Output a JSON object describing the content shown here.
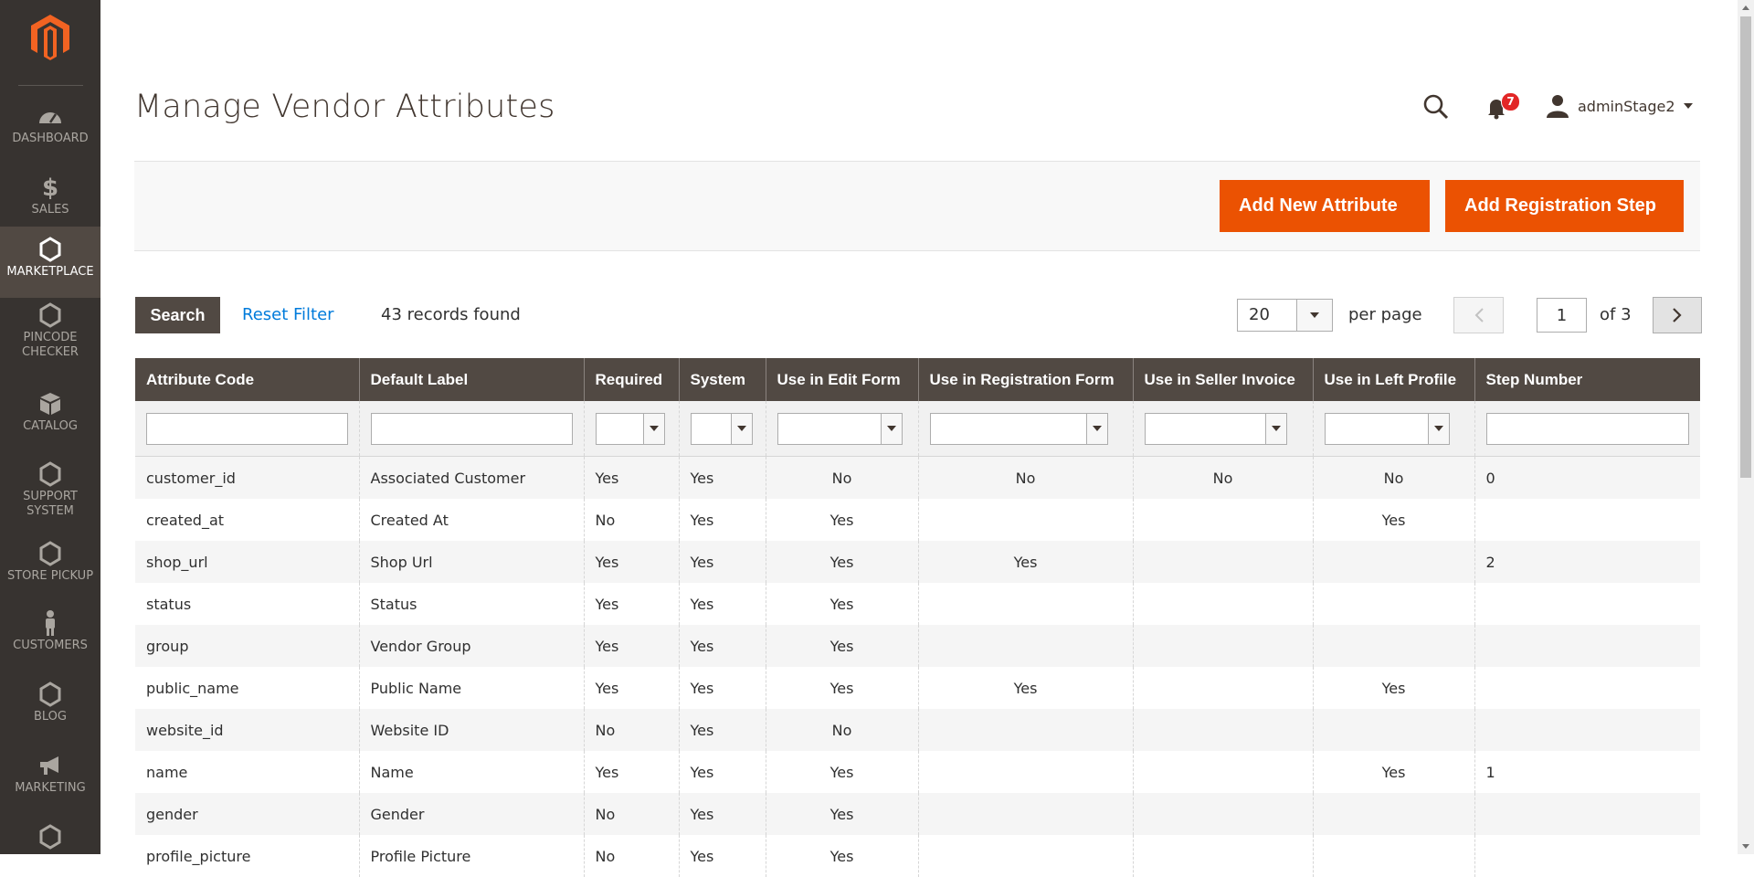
{
  "page": {
    "title": "Manage Vendor Attributes"
  },
  "header": {
    "notifications_count": "7",
    "username": "adminStage2"
  },
  "nav": [
    {
      "label": "DASHBOARD",
      "icon": "dashboard-icon"
    },
    {
      "label": "SALES",
      "icon": "dollar-icon"
    },
    {
      "label": "MARKETPLACE",
      "icon": "hexagon-icon",
      "active": true
    },
    {
      "label": "PINCODE CHECKER",
      "icon": "hexagon-icon"
    },
    {
      "label": "CATALOG",
      "icon": "box-icon"
    },
    {
      "label": "SUPPORT SYSTEM",
      "icon": "hexagon-icon"
    },
    {
      "label": "STORE PICKUP",
      "icon": "hexagon-icon"
    },
    {
      "label": "CUSTOMERS",
      "icon": "person-icon"
    },
    {
      "label": "BLOG",
      "icon": "hexagon-icon"
    },
    {
      "label": "MARKETING",
      "icon": "megaphone-icon"
    },
    {
      "label": "",
      "icon": "hexagon-icon"
    }
  ],
  "actions": {
    "add_attribute": "Add New Attribute",
    "add_step": "Add Registration Step"
  },
  "toolbar": {
    "search_label": "Search",
    "reset_label": "Reset Filter",
    "records": "43 records found",
    "per_page_value": "20",
    "per_page_label": "per page",
    "page_value": "1",
    "page_of": "of 3"
  },
  "table": {
    "columns": [
      "Attribute Code",
      "Default Label",
      "Required",
      "System",
      "Use in Edit Form",
      "Use in Registration Form",
      "Use in Seller Invoice",
      "Use in Left Profile",
      "Step Number"
    ],
    "rows": [
      [
        "customer_id",
        "Associated Customer",
        "Yes",
        "Yes",
        "No",
        "No",
        "No",
        "No",
        "0"
      ],
      [
        "created_at",
        "Created At",
        "No",
        "Yes",
        "Yes",
        "",
        "",
        "Yes",
        ""
      ],
      [
        "shop_url",
        "Shop Url",
        "Yes",
        "Yes",
        "Yes",
        "Yes",
        "",
        "",
        "2"
      ],
      [
        "status",
        "Status",
        "Yes",
        "Yes",
        "Yes",
        "",
        "",
        "",
        ""
      ],
      [
        "group",
        "Vendor Group",
        "Yes",
        "Yes",
        "Yes",
        "",
        "",
        "",
        ""
      ],
      [
        "public_name",
        "Public Name",
        "Yes",
        "Yes",
        "Yes",
        "Yes",
        "",
        "Yes",
        ""
      ],
      [
        "website_id",
        "Website ID",
        "No",
        "Yes",
        "No",
        "",
        "",
        "",
        ""
      ],
      [
        "name",
        "Name",
        "Yes",
        "Yes",
        "Yes",
        "",
        "",
        "Yes",
        "1"
      ],
      [
        "gender",
        "Gender",
        "No",
        "Yes",
        "Yes",
        "",
        "",
        "",
        ""
      ],
      [
        "profile_picture",
        "Profile Picture",
        "No",
        "Yes",
        "Yes",
        "",
        "",
        "",
        ""
      ]
    ]
  },
  "colors": {
    "sidebar": "#373330",
    "accent": "#eb5202",
    "table_header": "#514943",
    "link": "#007bdb"
  }
}
